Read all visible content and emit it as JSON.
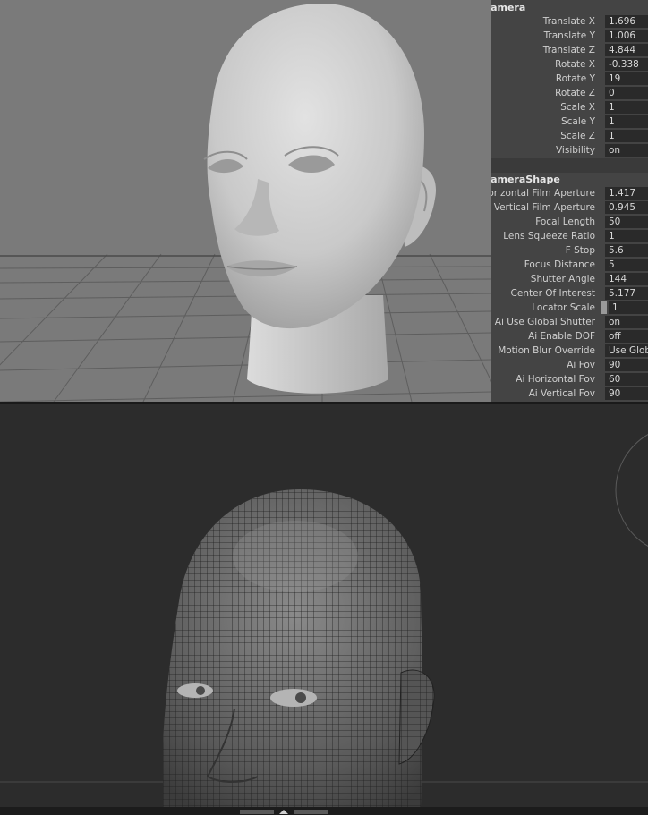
{
  "channel_box": {
    "camera_section": "Camera",
    "camera_attrs": [
      {
        "label": "Translate X",
        "value": "1.696"
      },
      {
        "label": "Translate Y",
        "value": "1.006"
      },
      {
        "label": "Translate Z",
        "value": "4.844"
      },
      {
        "label": "Rotate X",
        "value": "-0.338"
      },
      {
        "label": "Rotate Y",
        "value": "19"
      },
      {
        "label": "Rotate Z",
        "value": "0"
      },
      {
        "label": "Scale X",
        "value": "1"
      },
      {
        "label": "Scale Y",
        "value": "1"
      },
      {
        "label": "Scale Z",
        "value": "1"
      },
      {
        "label": "Visibility",
        "value": "on"
      }
    ],
    "shape_section": "CameraShape",
    "shape_attrs": [
      {
        "label": "Horizontal Film Aperture",
        "value": "1.417"
      },
      {
        "label": "Vertical Film Aperture",
        "value": "0.945"
      },
      {
        "label": "Focal Length",
        "value": "50"
      },
      {
        "label": "Lens Squeeze Ratio",
        "value": "1"
      },
      {
        "label": "F Stop",
        "value": "5.6"
      },
      {
        "label": "Focus Distance",
        "value": "5"
      },
      {
        "label": "Shutter Angle",
        "value": "144"
      },
      {
        "label": "Center Of Interest",
        "value": "5.177"
      },
      {
        "label": "Locator Scale",
        "value": "1"
      },
      {
        "label": "Ai Use Global Shutter",
        "value": "on"
      },
      {
        "label": "Ai Enable DOF",
        "value": "off"
      },
      {
        "label": "Motion Blur Override",
        "value": "Use Glob"
      },
      {
        "label": "Ai Fov",
        "value": "90"
      },
      {
        "label": "Ai Horizontal Fov",
        "value": "60"
      },
      {
        "label": "Ai Vertical Fov",
        "value": "90"
      }
    ]
  },
  "colors": {
    "viewport_top_bg": "#7a7a7a",
    "viewport_bottom_bg": "#2c2c2c",
    "channel_box_bg": "#444444",
    "field_bg": "#2a2a2a"
  },
  "icons": [
    "head-model-shaded",
    "head-model-wireframe",
    "ground-grid",
    "view-cube-ring",
    "pane-resize-handle-icon"
  ]
}
